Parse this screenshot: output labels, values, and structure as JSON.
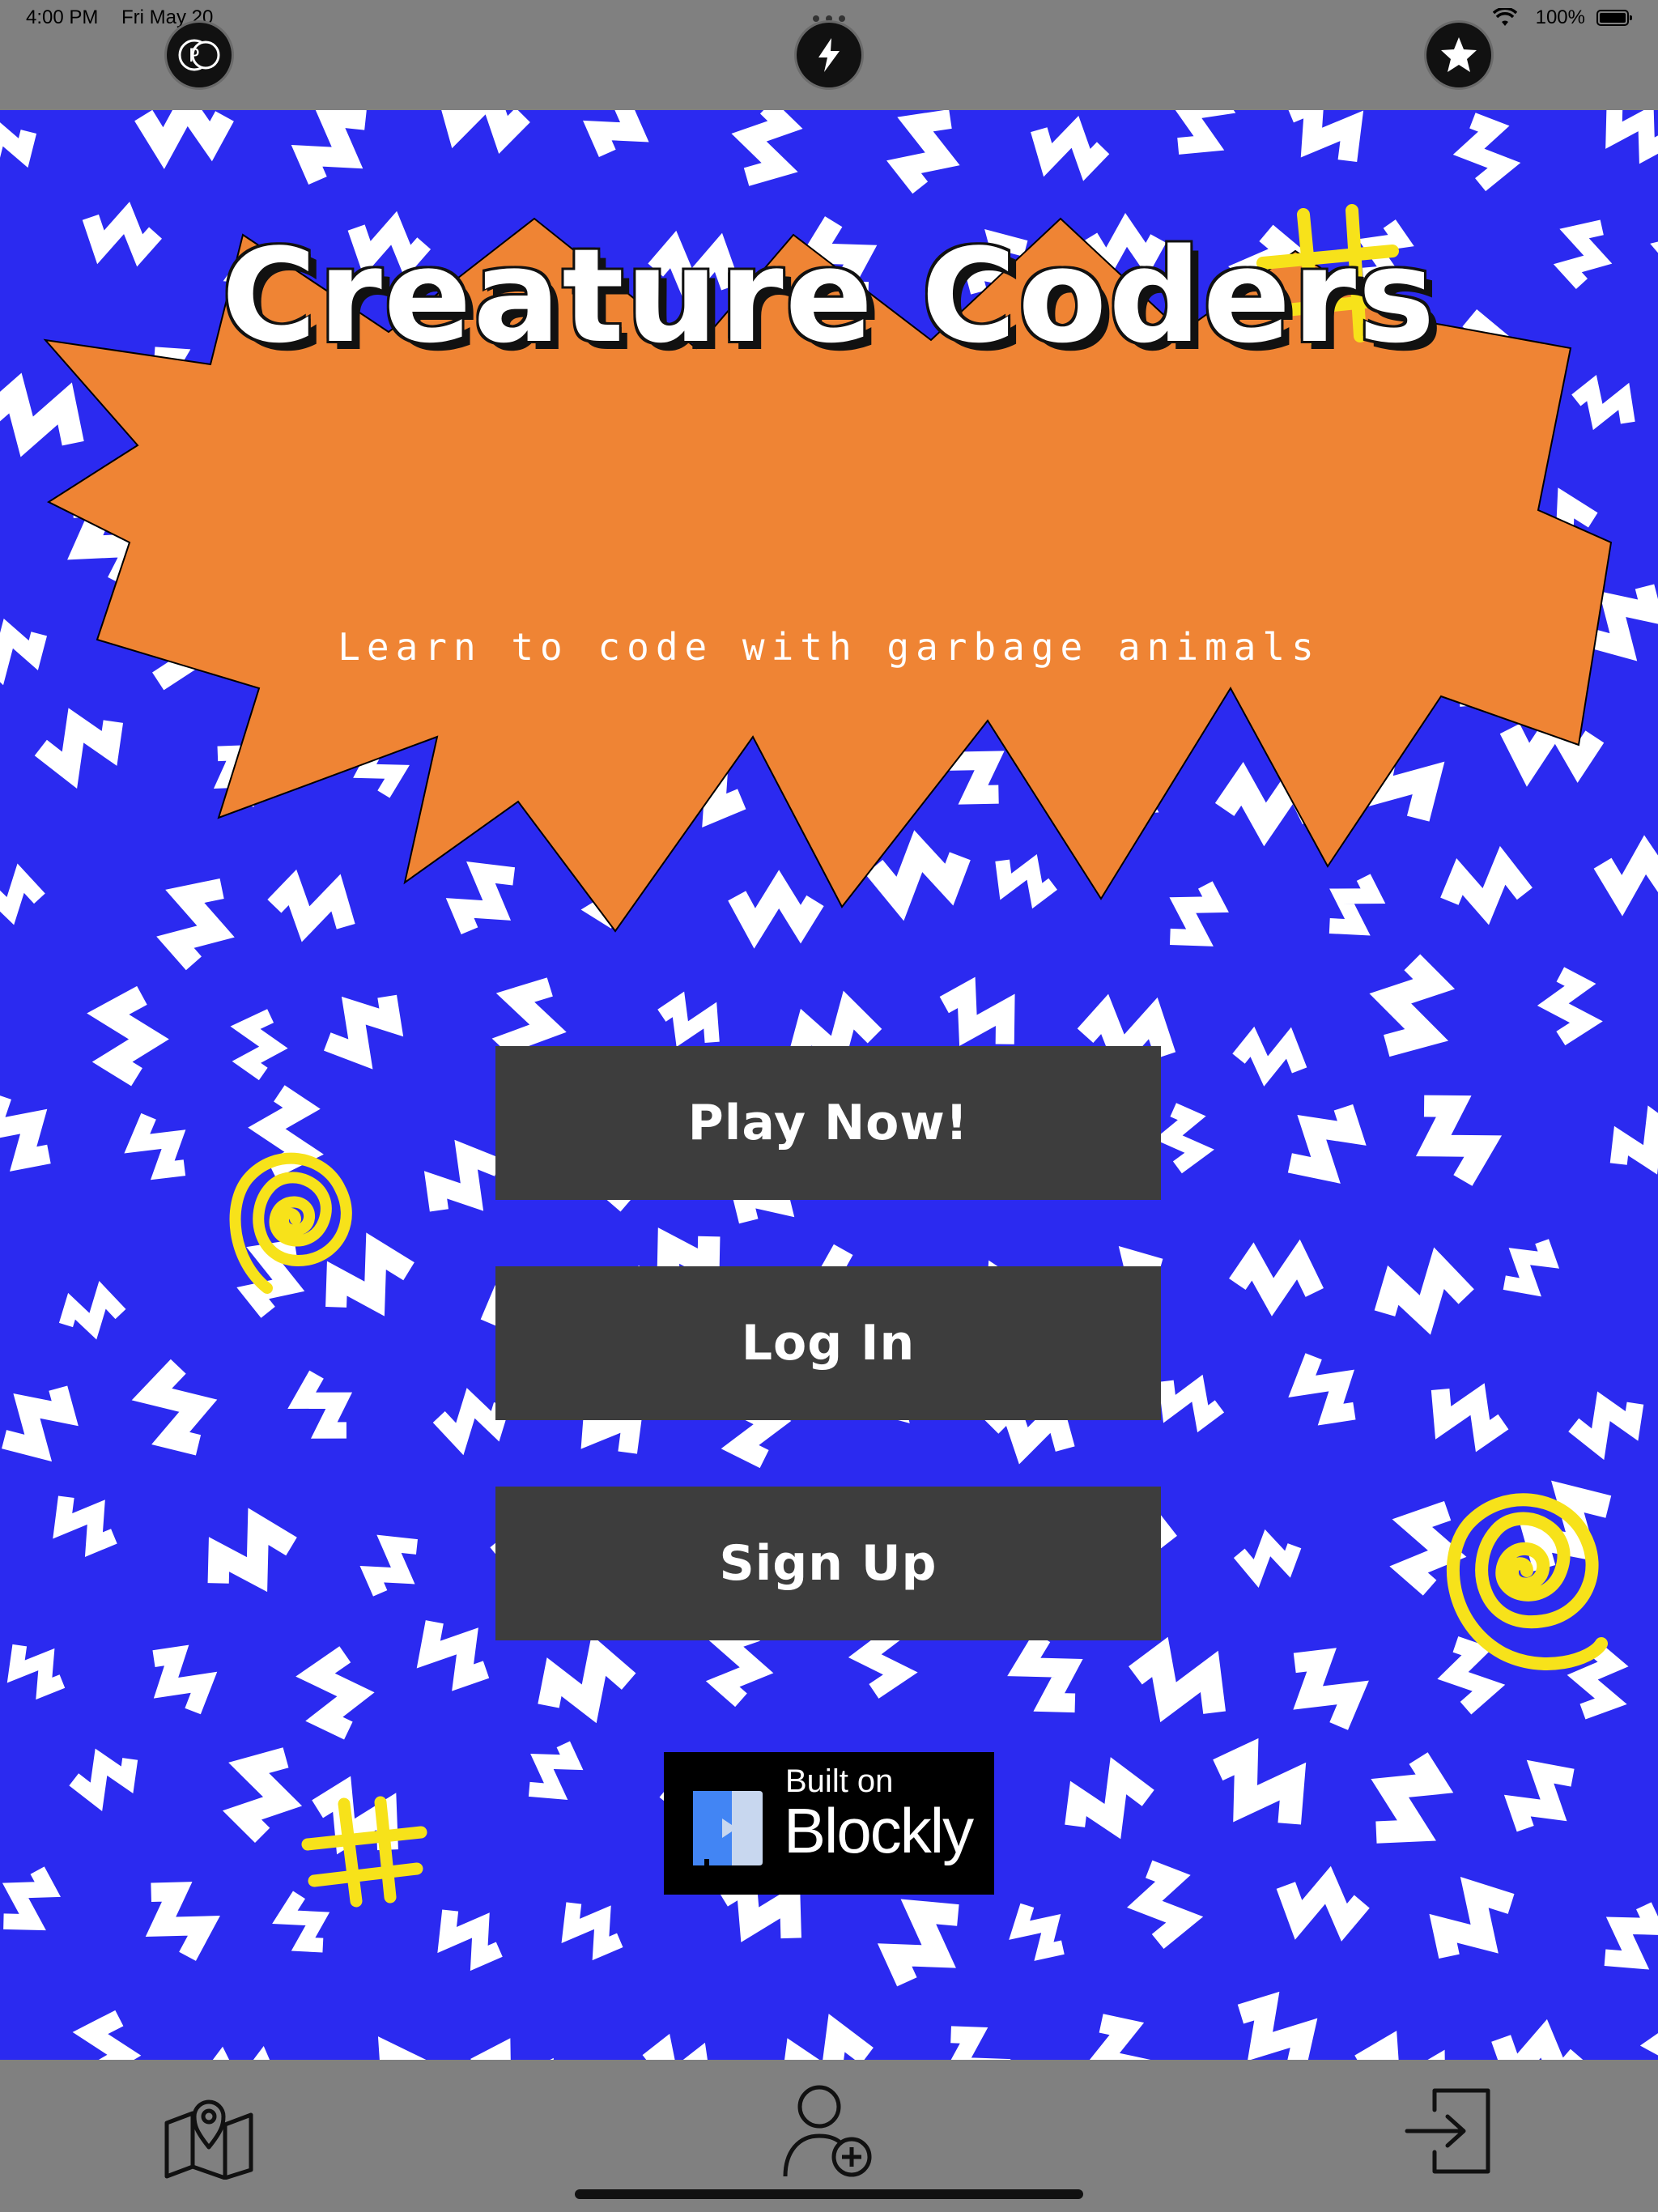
{
  "status_bar": {
    "time": "4:00 PM",
    "date": "Fri May 20",
    "battery": "100%"
  },
  "top_buttons": {
    "left_icon": "coin-icon",
    "center_icon": "lightning-icon",
    "right_icon": "star-icon"
  },
  "hero": {
    "title": "Creature Coders",
    "subtitle": "Learn to code with garbage animals"
  },
  "menu": {
    "play_label": "Play Now!",
    "login_label": "Log In",
    "signup_label": "Sign Up"
  },
  "badge": {
    "line1": "Built on",
    "line2": "Blockly"
  },
  "tab_bar": {
    "items": [
      {
        "icon": "map-pin-icon"
      },
      {
        "icon": "add-user-icon"
      },
      {
        "icon": "login-icon"
      }
    ]
  },
  "colors": {
    "background_blue": "#2b2af0",
    "starburst_orange": "#ef8434",
    "doodle_yellow": "#f7e21a",
    "button_gray": "#3d3d3d",
    "bar_gray": "#808080"
  }
}
